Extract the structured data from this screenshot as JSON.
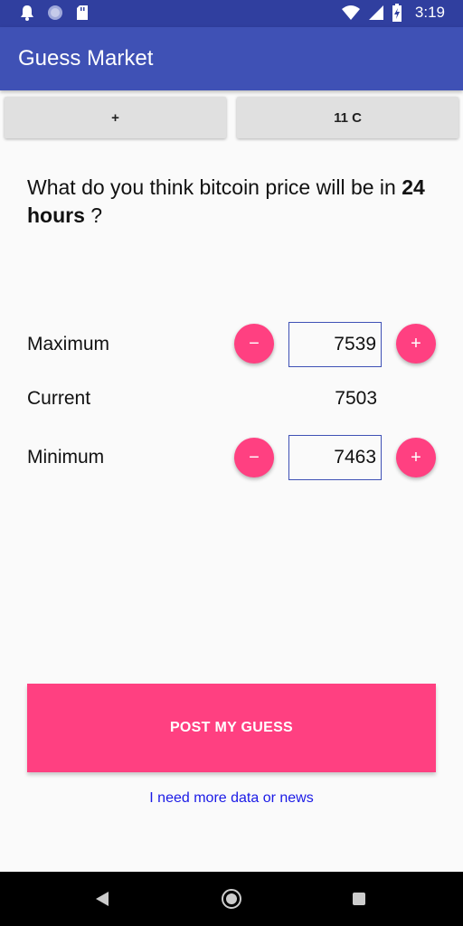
{
  "status_bar": {
    "time": "3:19",
    "left_icons": [
      "bell-icon",
      "circle-icon",
      "sd-card-icon"
    ],
    "right_icons": [
      "wifi-icon",
      "signal-icon",
      "battery-charging-icon"
    ]
  },
  "app_bar": {
    "title": "Guess Market"
  },
  "top_buttons": {
    "plus_label": "+",
    "coins_label": "11 C"
  },
  "question": {
    "text_before": "What do you think bitcoin price will be in ",
    "emphasis": "24 hours",
    "text_after": " ?"
  },
  "maximum": {
    "label": "Maximum",
    "value": "7539",
    "minus_label": "−",
    "plus_label": "+"
  },
  "current": {
    "label": "Current",
    "value": "7503"
  },
  "minimum": {
    "label": "Minimum",
    "value": "7463",
    "minus_label": "−",
    "plus_label": "+"
  },
  "post_button": {
    "label": "POST MY GUESS"
  },
  "more_link": {
    "label": "I need more data or news"
  },
  "colors": {
    "primary": "#3f51b5",
    "primary_dark": "#303f9f",
    "accent": "#ff4081",
    "link": "#1a1ae6"
  }
}
